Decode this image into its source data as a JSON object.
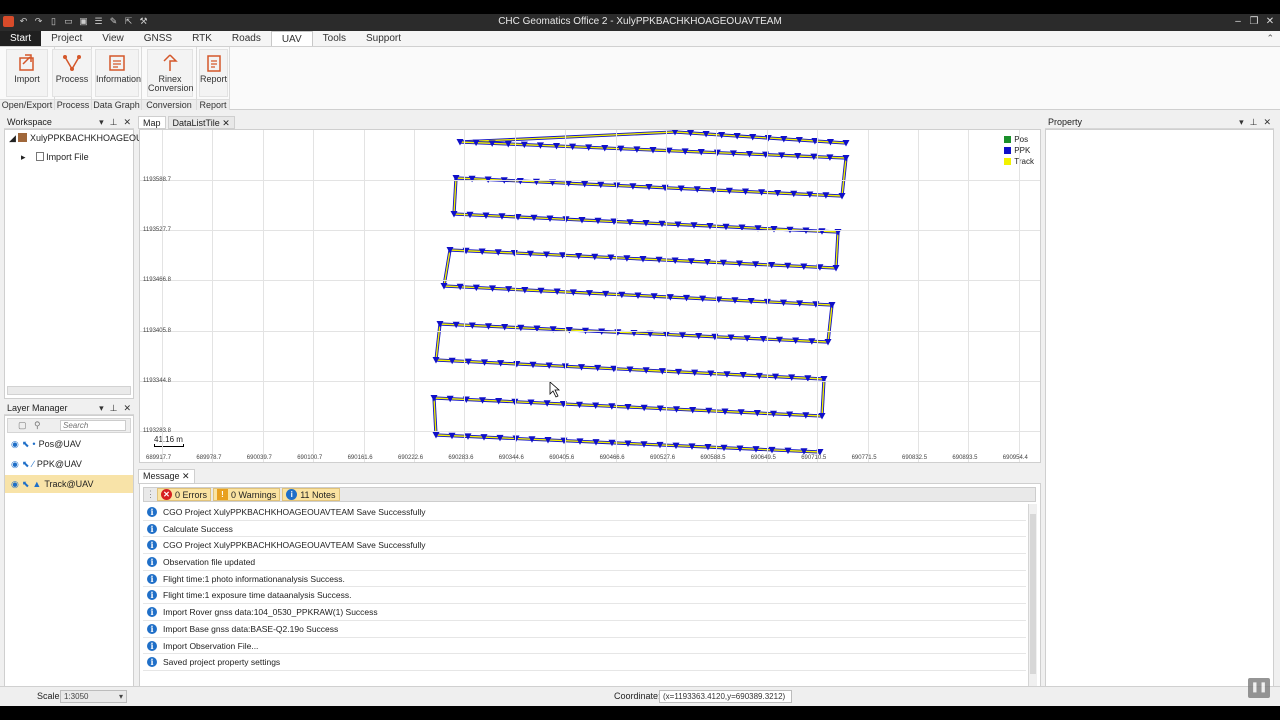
{
  "window": {
    "title": "CHC Geomatics Office 2 - XulyPPKBACHKHOAGEOUAVTEAM"
  },
  "menu_tabs": [
    "Start",
    "Project",
    "View",
    "GNSS",
    "RTK",
    "Roads",
    "UAV",
    "Tools",
    "Support"
  ],
  "ribbon": {
    "buttons": {
      "import": "Import",
      "process": "Process",
      "information": "Information",
      "rinex1": "Rinex",
      "rinex2": "Conversion",
      "report": "Report"
    },
    "groups": {
      "open_export": "Open/Export",
      "process": "Process",
      "data_graph": "Data Graph",
      "conversion": "Conversion",
      "report": "Report"
    }
  },
  "workspace": {
    "title": "Workspace",
    "project": "XulyPPKBACHKHOAGEOUAV",
    "child": "Import File"
  },
  "layer_manager": {
    "title": "Layer Manager",
    "search_placeholder": "Search",
    "layers": [
      "Pos@UAV",
      "PPK@UAV",
      "Track@UAV"
    ]
  },
  "doc_tabs": [
    "Map",
    "DataListTile"
  ],
  "map": {
    "y_labels": [
      "1193588.7",
      "1193527.7",
      "1193466.8",
      "1193405.8",
      "1193344.8",
      "1193283.8"
    ],
    "x_labels": [
      "689917.7",
      "689978.7",
      "690039.7",
      "690100.7",
      "690161.6",
      "690222.6",
      "690283.6",
      "690344.6",
      "690405.6",
      "690466.6",
      "690527.6",
      "690588.5",
      "690649.5",
      "690710.5",
      "690771.5",
      "690832.5",
      "690893.5",
      "690954.4"
    ],
    "legend": [
      {
        "label": "Pos",
        "color": "#1a8f2a"
      },
      {
        "label": "PPK",
        "color": "#1010c8"
      },
      {
        "label": "Track",
        "color": "#f2f200"
      }
    ],
    "scale_text": "41.16 m"
  },
  "message": {
    "tab": "Message",
    "errors": "0 Errors",
    "warnings": "0 Warnings",
    "notes": "11 Notes",
    "rows": [
      "CGO Project XulyPPKBACHKHOAGEOUAVTEAM Save Successfully",
      "Calculate Success",
      "CGO Project XulyPPKBACHKHOAGEOUAVTEAM Save Successfully",
      "Observation file updated",
      "Flight time:1 photo informationanalysis Success.",
      "Flight time:1 exposure time dataanalysis Success.",
      "Import Rover gnss data:104_0530_PPKRAW(1) Success",
      "Import Base gnss data:BASE-Q2.19o Success",
      "Import Observation File...",
      "Saved project property settings"
    ]
  },
  "property": {
    "title": "Property"
  },
  "status": {
    "scale_label": "Scale:",
    "scale_value": "1:3050",
    "coordinate_label": "Coordinate:",
    "coordinate_value": "(x=1193363.4120,y=690389.3212)"
  }
}
